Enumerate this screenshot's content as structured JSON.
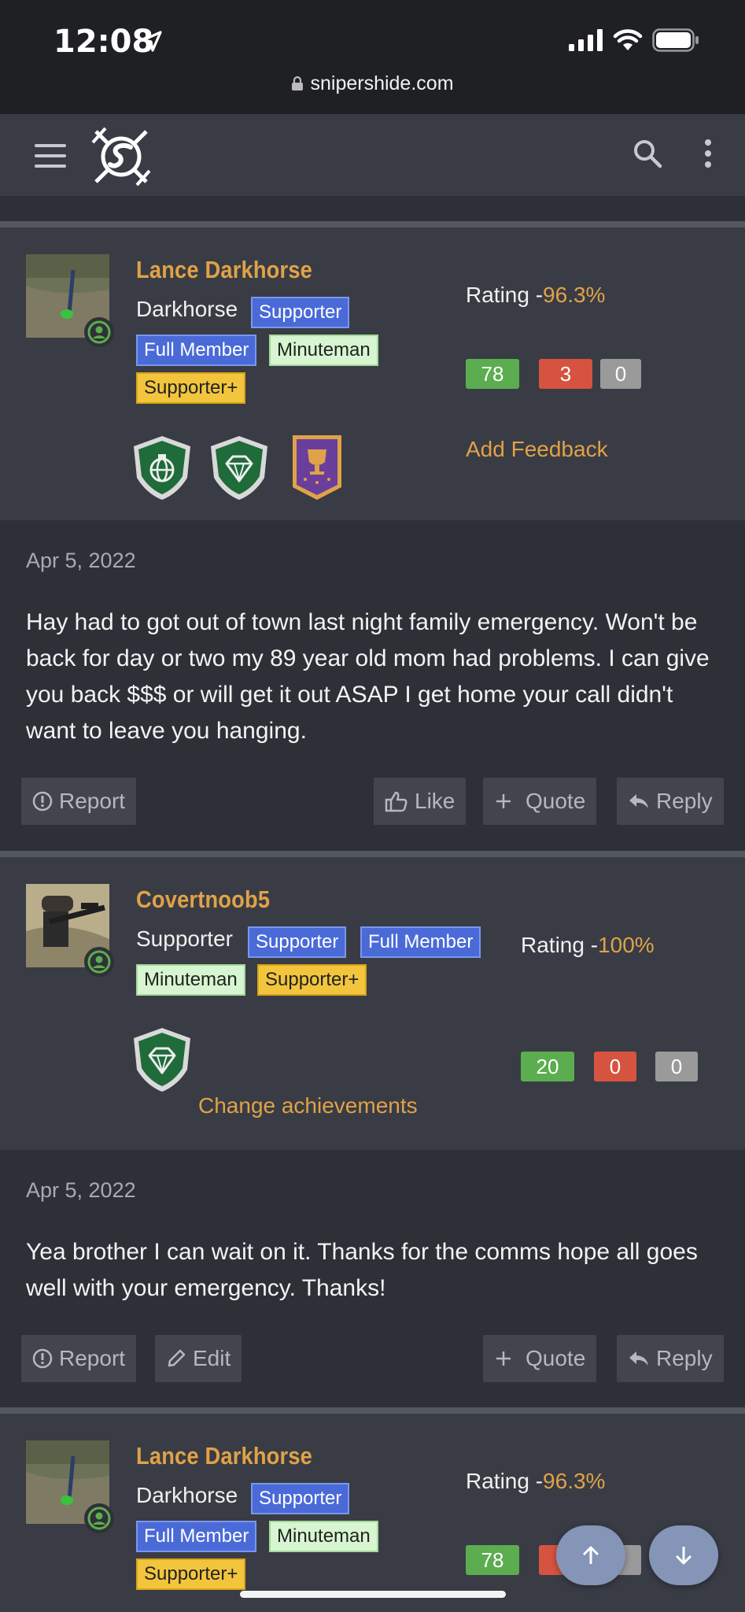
{
  "status_bar": {
    "time": "12:08",
    "url": "snipershide.com"
  },
  "icons": {
    "menu": "hamburger-menu-icon",
    "logo": "snipershide-logo",
    "search": "search-icon",
    "more": "vertical-ellipsis-icon"
  },
  "posts": [
    {
      "username": "Lance Darkhorse",
      "user_title": "Darkhorse",
      "badges": [
        "Supporter",
        "Full Member",
        "Minuteman",
        "Supporter+"
      ],
      "rating_label": "Rating -",
      "rating_value": "96.3%",
      "feedback": {
        "positive": "78",
        "negative": "3",
        "neutral": "0"
      },
      "feedback_link": "Add Feedback",
      "date": "Apr 5, 2022",
      "text": "Hay had to got out of town last night family emergency. Won't be back for day or two my 89 year old mom had problems. I can give you back $$$ or will get it out ASAP I get home your call didn't want to leave you hanging.",
      "actions": {
        "report": "Report",
        "like": "Like",
        "quote": "Quote",
        "reply": "Reply"
      }
    },
    {
      "username": "Covertnoob5",
      "user_title": "Supporter",
      "badges": [
        "Supporter",
        "Full Member",
        "Minuteman",
        "Supporter+"
      ],
      "rating_label": "Rating -",
      "rating_value": "100%",
      "feedback": {
        "positive": "20",
        "negative": "0",
        "neutral": "0"
      },
      "achievements_link": "Change achievements",
      "date": "Apr 5, 2022",
      "text": "Yea brother I can wait on it. Thanks for the comms hope all goes well with your emergency. Thanks!",
      "actions": {
        "report": "Report",
        "edit": "Edit",
        "quote": "Quote",
        "reply": "Reply"
      }
    },
    {
      "username": "Lance Darkhorse",
      "user_title": "Darkhorse",
      "badges": [
        "Supporter",
        "Full Member",
        "Minuteman",
        "Supporter+"
      ],
      "rating_label": "Rating -",
      "rating_value": "96.3%",
      "feedback": {
        "positive": "78",
        "negative": "3"
      }
    }
  ],
  "colors": {
    "accent": "#e0a248",
    "background": "#2e3038",
    "header": "#393c44",
    "badge_blue": "#4a6ad8",
    "badge_green": "#d6f5d0",
    "badge_yellow": "#f2c53d"
  }
}
